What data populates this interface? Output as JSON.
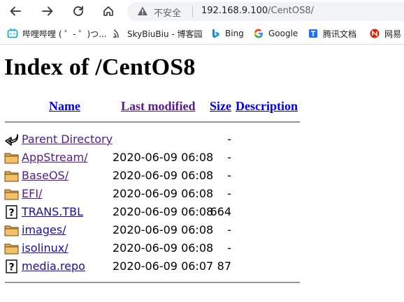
{
  "omnibox": {
    "security_label": "不安全",
    "url_host": "192.168.9.100",
    "url_path": "/CentOS8/"
  },
  "bookmarks": [
    {
      "label": "哔哩哔哩 ( ゜- ゜)つ...",
      "icon": "bilibili-icon"
    },
    {
      "label": "SkyBiuBiu - 博客园",
      "icon": "cnblogs-icon"
    },
    {
      "label": "Bing",
      "icon": "bing-icon"
    },
    {
      "label": "Google",
      "icon": "google-icon"
    },
    {
      "label": "腾讯文档",
      "icon": "tencent-docs-icon"
    },
    {
      "label": "网易",
      "icon": "netease-icon"
    }
  ],
  "page": {
    "title": "Index of /CentOS8",
    "columns": {
      "name": "Name",
      "last_modified": "Last modified",
      "size": "Size",
      "description": "Description"
    }
  },
  "entries": [
    {
      "name": "Parent Directory",
      "modified": "",
      "size": "-",
      "type": "parent"
    },
    {
      "name": "AppStream/",
      "modified": "2020-06-09 06:08",
      "size": "-",
      "type": "folder"
    },
    {
      "name": "BaseOS/",
      "modified": "2020-06-09 06:08",
      "size": "-",
      "type": "folder"
    },
    {
      "name": "EFI/",
      "modified": "2020-06-09 06:08",
      "size": "-",
      "type": "folder"
    },
    {
      "name": "TRANS.TBL",
      "modified": "2020-06-09 06:08",
      "size": "664",
      "type": "file"
    },
    {
      "name": "images/",
      "modified": "2020-06-09 06:08",
      "size": "-",
      "type": "folder"
    },
    {
      "name": "isolinux/",
      "modified": "2020-06-09 06:08",
      "size": "-",
      "type": "folder"
    },
    {
      "name": "media.repo",
      "modified": "2020-06-09 06:07",
      "size": "87",
      "type": "file"
    }
  ]
}
